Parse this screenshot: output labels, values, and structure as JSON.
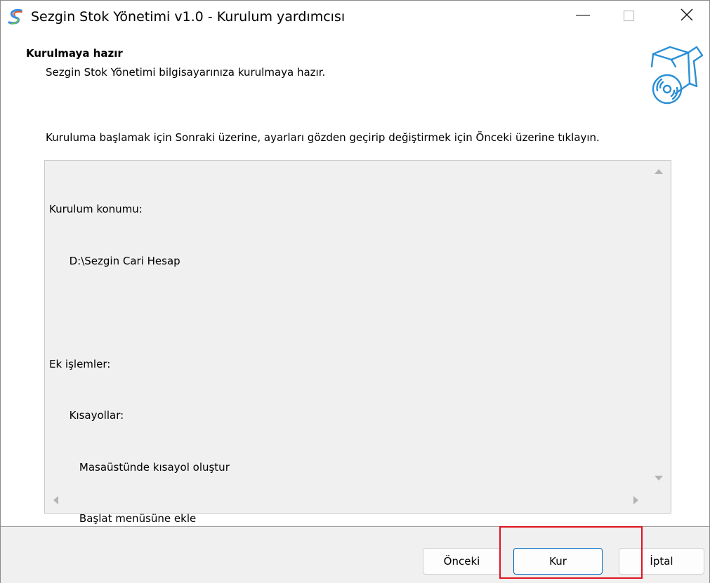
{
  "window": {
    "title": "Sezgin Stok Yönetimi v1.0 - Kurulum yardımcısı",
    "app_icon": "app-logo-icon",
    "controls": [
      "minimize-icon",
      "maximize-icon",
      "close-icon"
    ]
  },
  "header": {
    "title": "Kurulmaya hazır",
    "subtitle": "Sezgin Stok Yönetimi bilgisayarınıza kurulmaya hazır.",
    "icon": "setup-box-disc-icon"
  },
  "instruction": "Kuruluma başlamak için Sonraki üzerine, ayarları gözden geçirip değiştirmek için Önceki üzerine tıklayın.",
  "summary": {
    "lines": [
      "Kurulum konumu:",
      "      D:\\Sezgin Cari Hesap",
      "",
      "Ek işlemler:",
      "      Kısayollar:",
      "         Masaüstünde kısayol oluştur",
      "         Başlat menüsüne ekle"
    ]
  },
  "buttons": {
    "back": "Önceki",
    "install": "Kur",
    "cancel": "İptal"
  },
  "colors": {
    "accent": "#0067c0",
    "highlight": "#e0141e",
    "footer_bg": "#f0f0f0"
  }
}
